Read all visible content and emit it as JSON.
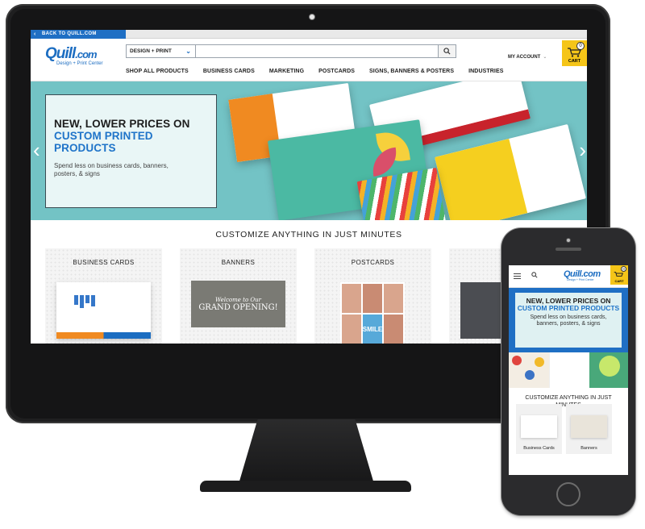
{
  "desktop": {
    "back_link": "BACK TO QUILL.COM",
    "logo": {
      "main": "Quill",
      "suffix": ".com",
      "subtitle": "Design + Print Center"
    },
    "search": {
      "category": "DESIGN + PRINT",
      "placeholder": ""
    },
    "account": {
      "label": "MY ACCOUNT"
    },
    "cart": {
      "label": "CART",
      "count": "0"
    },
    "nav": [
      "SHOP ALL PRODUCTS",
      "BUSINESS CARDS",
      "MARKETING",
      "POSTCARDS",
      "SIGNS, BANNERS & POSTERS",
      "INDUSTRIES"
    ],
    "hero": {
      "headline_black": "NEW, LOWER PRICES ON",
      "headline_blue": "CUSTOM PRINTED PRODUCTS",
      "body": "Spend less on business cards, banners, posters, & signs"
    },
    "section_title": "CUSTOMIZE ANYTHING IN JUST MINUTES",
    "tiles": [
      {
        "title": "BUSINESS CARDS"
      },
      {
        "title": "BANNERS",
        "image_line1": "Welcome to Our",
        "image_line2": "GRAND OPENING!"
      },
      {
        "title": "POSTCARDS",
        "image_text": "SMILE"
      },
      {
        "title": "PO"
      }
    ]
  },
  "mobile": {
    "logo": "Quill.com",
    "logo_sub": "Design + Print Center",
    "cart": {
      "label": "CART",
      "count": "0"
    },
    "hero": {
      "headline_black": "NEW, LOWER PRICES ON",
      "headline_blue": "CUSTOM PRINTED PRODUCTS",
      "body": "Spend less on business cards, banners, posters, & signs"
    },
    "section_title": "CUSTOMIZE ANYTHING IN JUST MINUTES",
    "tiles": [
      {
        "label": "Business Cards"
      },
      {
        "label": "Banners"
      }
    ]
  },
  "colors": {
    "brand_blue": "#1c6dc1",
    "cart_yellow": "#f5c518",
    "hero_teal": "#73c3c5"
  }
}
